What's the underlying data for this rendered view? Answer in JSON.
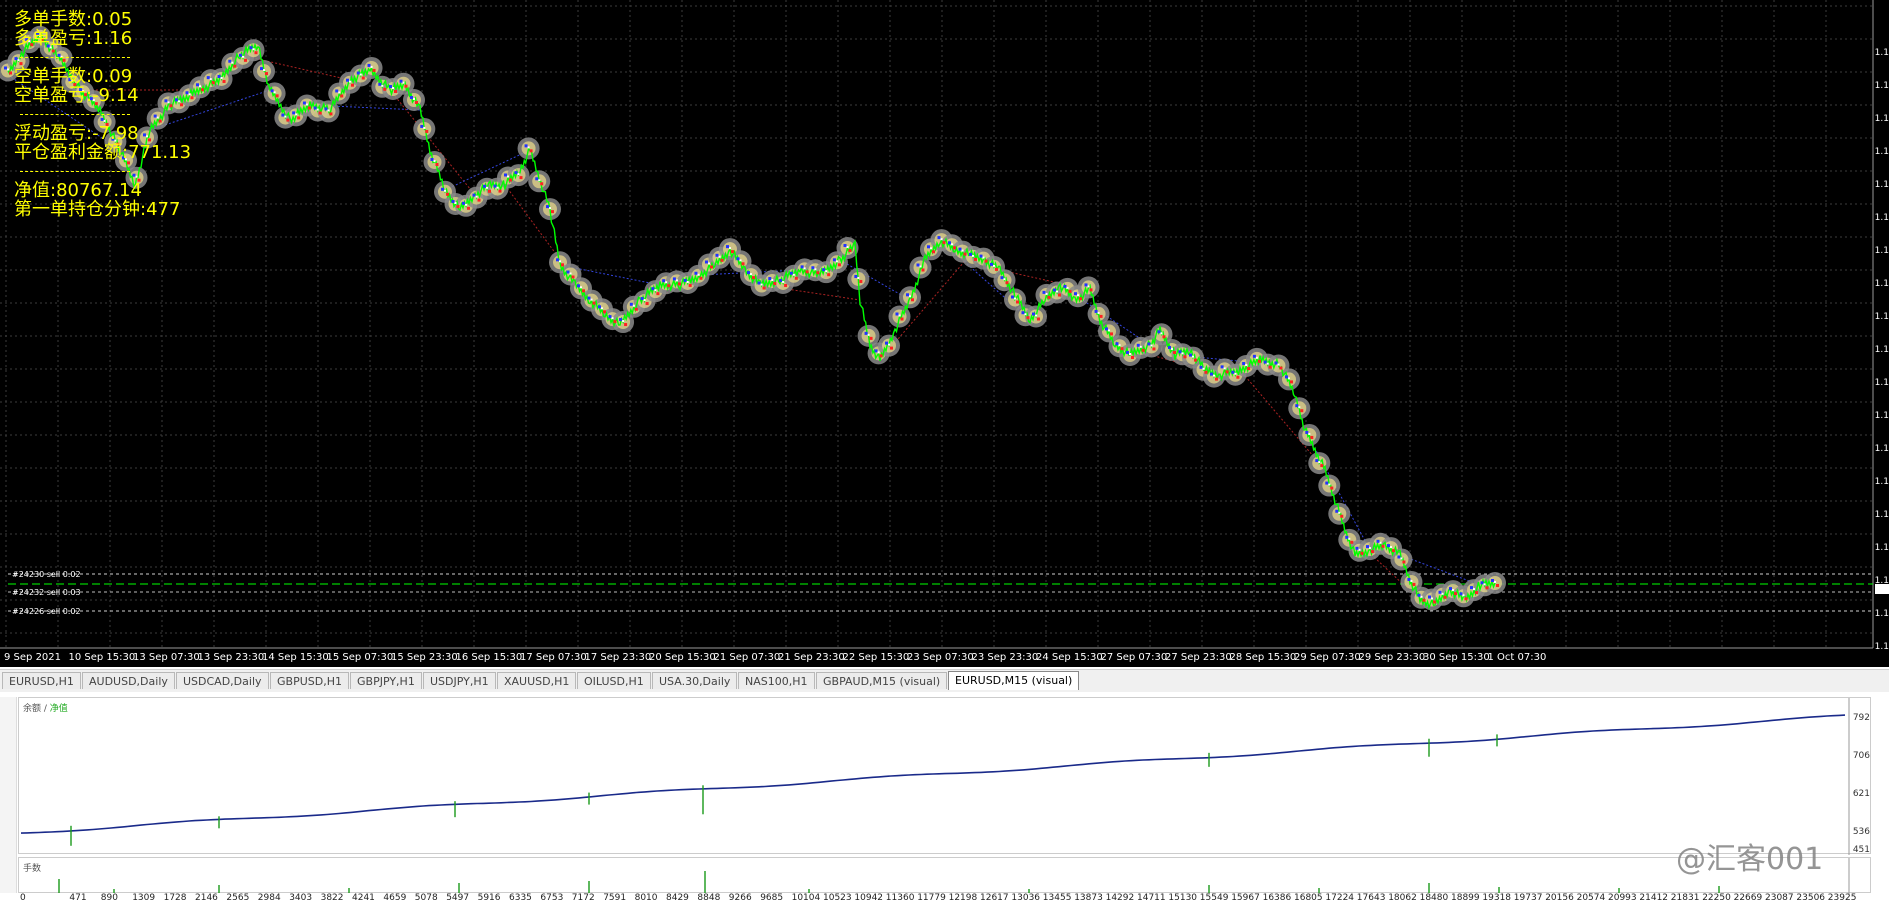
{
  "window_title": "EURUSD,M15 (visual)",
  "overlay": {
    "long_lots": "多单手数:0.05",
    "long_pnl": "多单盈亏:1.16",
    "short_lots": "空单手数:0.09",
    "short_pnl": "空单盈亏:-9.14",
    "floating_pnl": "浮动盈亏:-7.98",
    "closed_profit": "平仓盈利金额:771.13",
    "equity": "净值:80767.14",
    "first_order_minutes": "第一单持仓分钟:477"
  },
  "order_lines": [
    {
      "label": "#24230 sell 0.02"
    },
    {
      "label": "#24232 sell 0.03"
    },
    {
      "label": "#24226 sell 0.02"
    }
  ],
  "price_axis_labels": [
    "1.1",
    "1.1",
    "1.1",
    "1.1",
    "1.1",
    "1.1",
    "1.1",
    "1.1",
    "1.1",
    "1.1",
    "1.1",
    "1.1",
    "1.1",
    "1.1",
    "1.1",
    "1.1",
    "1.1",
    "1.1",
    "1.1"
  ],
  "time_axis": [
    "9 Sep 2021",
    "10 Sep 15:30",
    "13 Sep 07:30",
    "13 Sep 23:30",
    "14 Sep 15:30",
    "15 Sep 07:30",
    "15 Sep 23:30",
    "16 Sep 15:30",
    "17 Sep 07:30",
    "17 Sep 23:30",
    "20 Sep 15:30",
    "21 Sep 07:30",
    "21 Sep 23:30",
    "22 Sep 15:30",
    "23 Sep 07:30",
    "23 Sep 23:30",
    "24 Sep 15:30",
    "27 Sep 07:30",
    "27 Sep 23:30",
    "28 Sep 15:30",
    "29 Sep 07:30",
    "29 Sep 23:30",
    "30 Sep 15:30",
    "1 Oct 07:30"
  ],
  "tabs": [
    {
      "label": "EURUSD,H1",
      "active": false
    },
    {
      "label": "AUDUSD,Daily",
      "active": false
    },
    {
      "label": "USDCAD,Daily",
      "active": false
    },
    {
      "label": "GBPUSD,H1",
      "active": false
    },
    {
      "label": "GBPJPY,H1",
      "active": false
    },
    {
      "label": "USDJPY,H1",
      "active": false
    },
    {
      "label": "XAUUSD,H1",
      "active": false
    },
    {
      "label": "OILUSD,H1",
      "active": false
    },
    {
      "label": "USA.30,Daily",
      "active": false
    },
    {
      "label": "NAS100,H1",
      "active": false
    },
    {
      "label": "GBPAUD,M15 (visual)",
      "active": false
    },
    {
      "label": "EURUSD,M15 (visual)",
      "active": true
    }
  ],
  "equity_panel": {
    "label_balance": "余额",
    "label_sep": " / ",
    "label_equity": "净值",
    "y_labels": [
      "792",
      "706",
      "621",
      "536",
      "451"
    ]
  },
  "lots_panel": {
    "label": "手数"
  },
  "trade_axis": [
    "0",
    "471",
    "890",
    "1309",
    "1728",
    "2146",
    "2565",
    "2984",
    "3403",
    "3822",
    "4241",
    "4659",
    "5078",
    "5497",
    "5916",
    "6335",
    "6753",
    "7172",
    "7591",
    "8010",
    "8429",
    "8848",
    "9266",
    "9685",
    "10104",
    "10523",
    "10942",
    "11360",
    "11779",
    "12198",
    "12617",
    "13036",
    "13455",
    "13873",
    "14292",
    "14711",
    "15130",
    "15549",
    "15967",
    "16386",
    "16805",
    "17224",
    "17643",
    "18062",
    "18480",
    "18899",
    "19318",
    "19737",
    "20156",
    "20574",
    "20993",
    "21412",
    "21831",
    "22250",
    "22669",
    "23087",
    "23506",
    "23925"
  ],
  "watermark": "@汇客001",
  "colors": {
    "background": "#000000",
    "grid": "#3a3a3a",
    "price": "#00ff00",
    "overlay_text": "#ffff00",
    "balance": "#1a2a8a",
    "equity_spikes": "#1a9a1a"
  }
}
